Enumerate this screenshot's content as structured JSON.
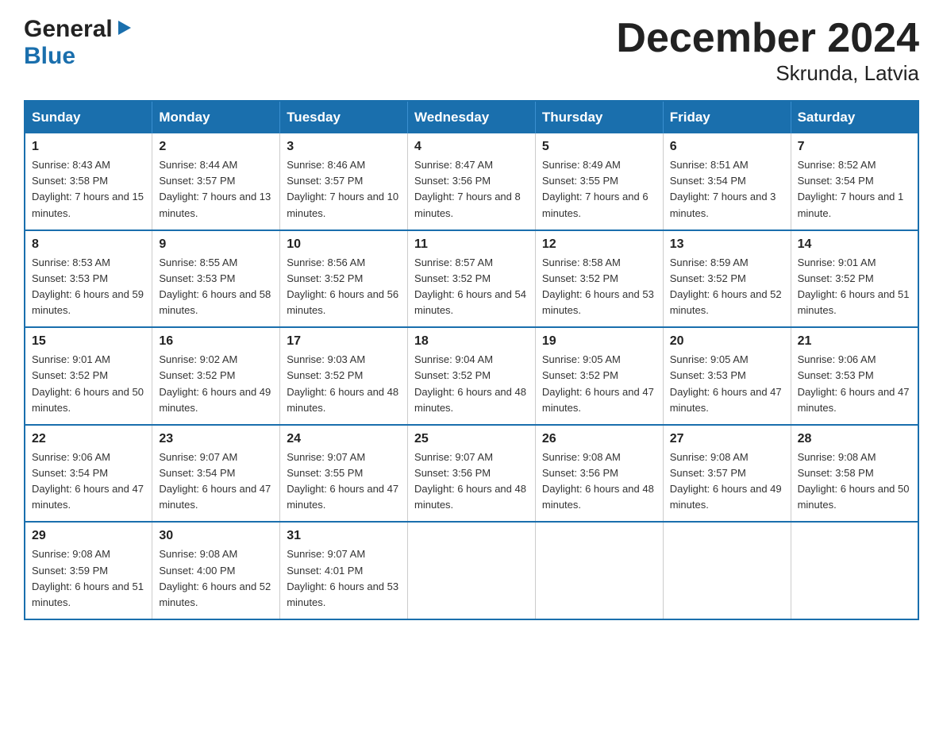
{
  "logo": {
    "general": "General",
    "blue": "Blue",
    "arrow": "▶"
  },
  "title": "December 2024",
  "subtitle": "Skrunda, Latvia",
  "weekdays": [
    "Sunday",
    "Monday",
    "Tuesday",
    "Wednesday",
    "Thursday",
    "Friday",
    "Saturday"
  ],
  "weeks": [
    [
      {
        "day": "1",
        "sunrise": "Sunrise: 8:43 AM",
        "sunset": "Sunset: 3:58 PM",
        "daylight": "Daylight: 7 hours and 15 minutes."
      },
      {
        "day": "2",
        "sunrise": "Sunrise: 8:44 AM",
        "sunset": "Sunset: 3:57 PM",
        "daylight": "Daylight: 7 hours and 13 minutes."
      },
      {
        "day": "3",
        "sunrise": "Sunrise: 8:46 AM",
        "sunset": "Sunset: 3:57 PM",
        "daylight": "Daylight: 7 hours and 10 minutes."
      },
      {
        "day": "4",
        "sunrise": "Sunrise: 8:47 AM",
        "sunset": "Sunset: 3:56 PM",
        "daylight": "Daylight: 7 hours and 8 minutes."
      },
      {
        "day": "5",
        "sunrise": "Sunrise: 8:49 AM",
        "sunset": "Sunset: 3:55 PM",
        "daylight": "Daylight: 7 hours and 6 minutes."
      },
      {
        "day": "6",
        "sunrise": "Sunrise: 8:51 AM",
        "sunset": "Sunset: 3:54 PM",
        "daylight": "Daylight: 7 hours and 3 minutes."
      },
      {
        "day": "7",
        "sunrise": "Sunrise: 8:52 AM",
        "sunset": "Sunset: 3:54 PM",
        "daylight": "Daylight: 7 hours and 1 minute."
      }
    ],
    [
      {
        "day": "8",
        "sunrise": "Sunrise: 8:53 AM",
        "sunset": "Sunset: 3:53 PM",
        "daylight": "Daylight: 6 hours and 59 minutes."
      },
      {
        "day": "9",
        "sunrise": "Sunrise: 8:55 AM",
        "sunset": "Sunset: 3:53 PM",
        "daylight": "Daylight: 6 hours and 58 minutes."
      },
      {
        "day": "10",
        "sunrise": "Sunrise: 8:56 AM",
        "sunset": "Sunset: 3:52 PM",
        "daylight": "Daylight: 6 hours and 56 minutes."
      },
      {
        "day": "11",
        "sunrise": "Sunrise: 8:57 AM",
        "sunset": "Sunset: 3:52 PM",
        "daylight": "Daylight: 6 hours and 54 minutes."
      },
      {
        "day": "12",
        "sunrise": "Sunrise: 8:58 AM",
        "sunset": "Sunset: 3:52 PM",
        "daylight": "Daylight: 6 hours and 53 minutes."
      },
      {
        "day": "13",
        "sunrise": "Sunrise: 8:59 AM",
        "sunset": "Sunset: 3:52 PM",
        "daylight": "Daylight: 6 hours and 52 minutes."
      },
      {
        "day": "14",
        "sunrise": "Sunrise: 9:01 AM",
        "sunset": "Sunset: 3:52 PM",
        "daylight": "Daylight: 6 hours and 51 minutes."
      }
    ],
    [
      {
        "day": "15",
        "sunrise": "Sunrise: 9:01 AM",
        "sunset": "Sunset: 3:52 PM",
        "daylight": "Daylight: 6 hours and 50 minutes."
      },
      {
        "day": "16",
        "sunrise": "Sunrise: 9:02 AM",
        "sunset": "Sunset: 3:52 PM",
        "daylight": "Daylight: 6 hours and 49 minutes."
      },
      {
        "day": "17",
        "sunrise": "Sunrise: 9:03 AM",
        "sunset": "Sunset: 3:52 PM",
        "daylight": "Daylight: 6 hours and 48 minutes."
      },
      {
        "day": "18",
        "sunrise": "Sunrise: 9:04 AM",
        "sunset": "Sunset: 3:52 PM",
        "daylight": "Daylight: 6 hours and 48 minutes."
      },
      {
        "day": "19",
        "sunrise": "Sunrise: 9:05 AM",
        "sunset": "Sunset: 3:52 PM",
        "daylight": "Daylight: 6 hours and 47 minutes."
      },
      {
        "day": "20",
        "sunrise": "Sunrise: 9:05 AM",
        "sunset": "Sunset: 3:53 PM",
        "daylight": "Daylight: 6 hours and 47 minutes."
      },
      {
        "day": "21",
        "sunrise": "Sunrise: 9:06 AM",
        "sunset": "Sunset: 3:53 PM",
        "daylight": "Daylight: 6 hours and 47 minutes."
      }
    ],
    [
      {
        "day": "22",
        "sunrise": "Sunrise: 9:06 AM",
        "sunset": "Sunset: 3:54 PM",
        "daylight": "Daylight: 6 hours and 47 minutes."
      },
      {
        "day": "23",
        "sunrise": "Sunrise: 9:07 AM",
        "sunset": "Sunset: 3:54 PM",
        "daylight": "Daylight: 6 hours and 47 minutes."
      },
      {
        "day": "24",
        "sunrise": "Sunrise: 9:07 AM",
        "sunset": "Sunset: 3:55 PM",
        "daylight": "Daylight: 6 hours and 47 minutes."
      },
      {
        "day": "25",
        "sunrise": "Sunrise: 9:07 AM",
        "sunset": "Sunset: 3:56 PM",
        "daylight": "Daylight: 6 hours and 48 minutes."
      },
      {
        "day": "26",
        "sunrise": "Sunrise: 9:08 AM",
        "sunset": "Sunset: 3:56 PM",
        "daylight": "Daylight: 6 hours and 48 minutes."
      },
      {
        "day": "27",
        "sunrise": "Sunrise: 9:08 AM",
        "sunset": "Sunset: 3:57 PM",
        "daylight": "Daylight: 6 hours and 49 minutes."
      },
      {
        "day": "28",
        "sunrise": "Sunrise: 9:08 AM",
        "sunset": "Sunset: 3:58 PM",
        "daylight": "Daylight: 6 hours and 50 minutes."
      }
    ],
    [
      {
        "day": "29",
        "sunrise": "Sunrise: 9:08 AM",
        "sunset": "Sunset: 3:59 PM",
        "daylight": "Daylight: 6 hours and 51 minutes."
      },
      {
        "day": "30",
        "sunrise": "Sunrise: 9:08 AM",
        "sunset": "Sunset: 4:00 PM",
        "daylight": "Daylight: 6 hours and 52 minutes."
      },
      {
        "day": "31",
        "sunrise": "Sunrise: 9:07 AM",
        "sunset": "Sunset: 4:01 PM",
        "daylight": "Daylight: 6 hours and 53 minutes."
      },
      null,
      null,
      null,
      null
    ]
  ]
}
